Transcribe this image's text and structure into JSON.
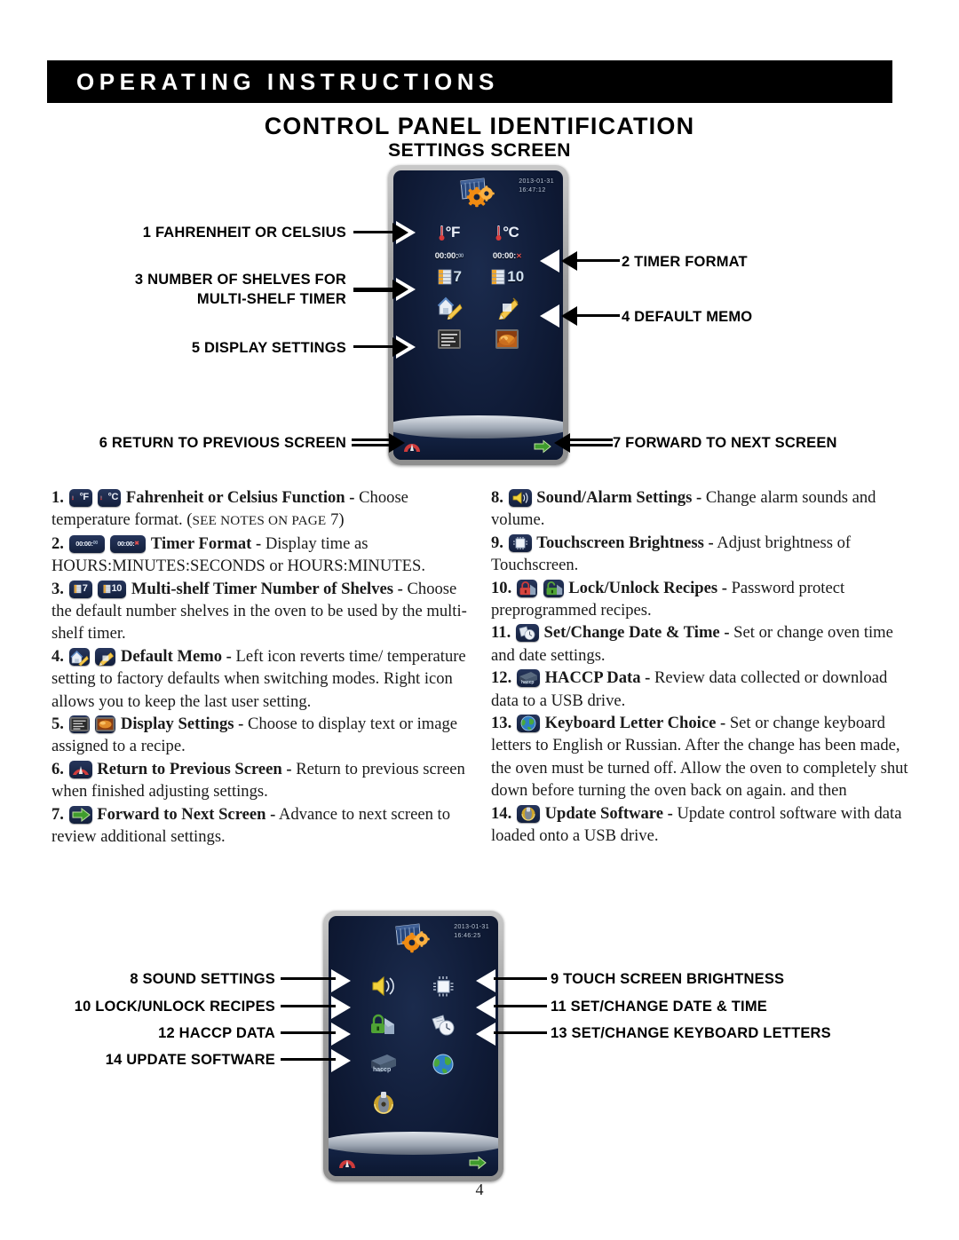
{
  "header": {
    "banner_title": "OPERATING INSTRUCTIONS",
    "page_title": "CONTROL PANEL IDENTIFICATION",
    "page_subtitle": "SETTINGS SCREEN"
  },
  "page_number": "4",
  "screen_one": {
    "date": "2013-01-31",
    "time": "16:47:12",
    "icons": {
      "fahrenheit": "°F",
      "celsius": "°C",
      "timer_hms": "00:00:",
      "timer_hms_sec": "00",
      "timer_hm": "00:00:",
      "timer_hm_x": "✕",
      "shelves_7": "7",
      "shelves_10": "10"
    },
    "nav": {
      "back": "return-arrow",
      "forward": "forward-arrow"
    }
  },
  "screen_two": {
    "date": "2013-01-31",
    "time": "16:46:25",
    "nav": {
      "back": "return-arrow",
      "forward": "forward-arrow"
    }
  },
  "callouts_screen_one": [
    {
      "id": 1,
      "text": "1 FAHRENHEIT OR CELSIUS",
      "side": "left"
    },
    {
      "id": 3,
      "line1": "3 NUMBER OF SHELVES FOR",
      "line2": "MULTI-SHELF TIMER",
      "side": "left"
    },
    {
      "id": 5,
      "text": "5 DISPLAY SETTINGS",
      "side": "left"
    },
    {
      "id": 6,
      "text": "6 RETURN TO PREVIOUS SCREEN",
      "side": "left"
    },
    {
      "id": 2,
      "text": "2 TIMER FORMAT",
      "side": "right"
    },
    {
      "id": 4,
      "text": "4 DEFAULT MEMO",
      "side": "right"
    },
    {
      "id": 7,
      "text": "7 FORWARD TO NEXT SCREEN",
      "side": "right"
    }
  ],
  "callouts_screen_two": [
    {
      "id": 8,
      "text": "8 SOUND SETTINGS",
      "side": "left"
    },
    {
      "id": 10,
      "text": "10 LOCK/UNLOCK RECIPES",
      "side": "left"
    },
    {
      "id": 12,
      "text": "12 HACCP DATA",
      "side": "left"
    },
    {
      "id": 14,
      "text": "14 UPDATE SOFTWARE",
      "side": "left"
    },
    {
      "id": 9,
      "text": "9 TOUCH SCREEN BRIGHTNESS",
      "side": "right"
    },
    {
      "id": 11,
      "text": "11 SET/CHANGE DATE & TIME",
      "side": "right"
    },
    {
      "id": 13,
      "text": "13 SET/CHANGE KEYBOARD LETTERS",
      "side": "right"
    }
  ],
  "descriptions_left": [
    {
      "num": "1.",
      "title": "Fahrenheit or Celsius Function -",
      "body": " Choose temperature format. (",
      "smallcaps": "SEE NOTES ON PAGE",
      "body_tail": " 7)"
    },
    {
      "num": "2.",
      "title": "Timer Format -",
      "body": " Display time as HOURS:MINUTES:SECONDS or HOURS:MINUTES."
    },
    {
      "num": "3.",
      "title": "Multi-shelf Timer Number of Shelves -",
      "body": " Choose the default number shelves in the oven to be used by the multi-shelf timer."
    },
    {
      "num": "4.",
      "title": "Default Memo -",
      "body": " Left icon reverts time/ temperature setting to factory defaults when switching modes. Right icon allows you to keep the last user setting."
    },
    {
      "num": "5.",
      "title": "Display Settings -",
      "body": " Choose to display text or image assigned to a recipe."
    },
    {
      "num": "6.",
      "title": "Return to Previous Screen -",
      "body": " Return to previous screen when finished adjusting settings."
    },
    {
      "num": "7.",
      "title": "Forward to Next Screen -",
      "body": " Advance to next screen to review additional settings."
    }
  ],
  "descriptions_right": [
    {
      "num": "8.",
      "title": "Sound/Alarm Settings -",
      "body": " Change alarm sounds and volume."
    },
    {
      "num": "9.",
      "title": "Touchscreen Brightness -",
      "body": " Adjust brightness of Touchscreen."
    },
    {
      "num": "10.",
      "title": "Lock/Unlock Recipes -",
      "body": " Password protect preprogrammed recipes."
    },
    {
      "num": "11.",
      "title": "Set/Change Date & Time -",
      "body": " Set or change oven time and date settings."
    },
    {
      "num": "12.",
      "title": "HACCP Data -",
      "body": " Review data collected or download data to a USB drive."
    },
    {
      "num": "13.",
      "title": "Keyboard Letter Choice -",
      "body": " Set or change keyboard letters to English or Russian. After the change has been made, the oven must be turned off. Allow the oven to completely shut down before turning the oven back on again. and then"
    },
    {
      "num": "14.",
      "title": "Update Software -",
      "body": " Update control software with data loaded onto a USB drive."
    }
  ],
  "colors": {
    "banner_bg": "#000000",
    "banner_text": "#ffffff",
    "screen_bg": "#101c38",
    "bezel": "#9d9d9d",
    "accent_orange": "#f29100",
    "accent_green": "#4caf2f",
    "accent_red": "#d03030"
  }
}
